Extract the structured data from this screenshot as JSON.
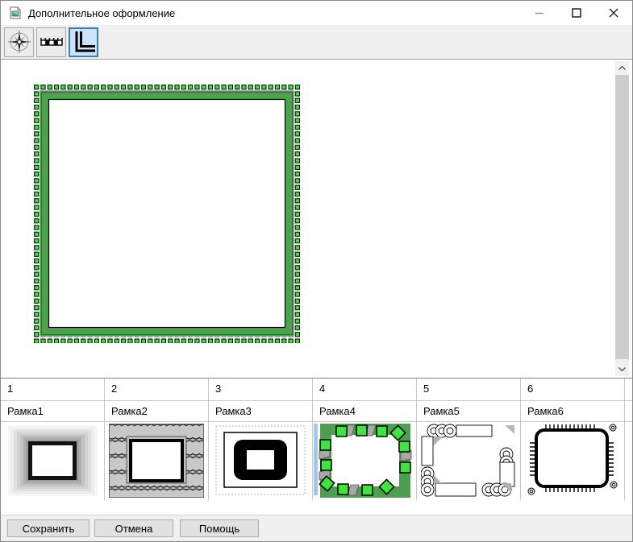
{
  "window": {
    "title": "Дополнительное оформление",
    "icon": "image-document-icon",
    "controls": {
      "minimize": "minimize",
      "maximize": "maximize",
      "close": "close"
    }
  },
  "toolbar": {
    "buttons": [
      {
        "id": "north-arrow",
        "icon": "compass-rose-icon",
        "selected": false
      },
      {
        "id": "scale-bar",
        "icon": "scale-bar-icon",
        "selected": false
      },
      {
        "id": "frame-corner",
        "icon": "frame-corner-icon",
        "selected": true
      }
    ]
  },
  "gallery": {
    "items": [
      {
        "number": "1",
        "name": "Рамка1",
        "selected": false
      },
      {
        "number": "2",
        "name": "Рамка2",
        "selected": false
      },
      {
        "number": "3",
        "name": "Рамка3",
        "selected": false
      },
      {
        "number": "4",
        "name": "Рамка4",
        "selected": true
      },
      {
        "number": "5",
        "name": "Рамка5",
        "selected": false
      },
      {
        "number": "6",
        "name": "Рамка6",
        "selected": false
      }
    ]
  },
  "footer": {
    "save": "Сохранить",
    "cancel": "Отмена",
    "help": "Помощь"
  },
  "colors": {
    "frame_band_green": "#4da24d",
    "frame_square_green": "#3fe23f",
    "toolbar_selected_bg": "#cce4f7",
    "toolbar_selected_border": "#3c7fb1",
    "selection_bar_blue": "#9ec9ee",
    "panel_gray": "#f0f0f0"
  }
}
